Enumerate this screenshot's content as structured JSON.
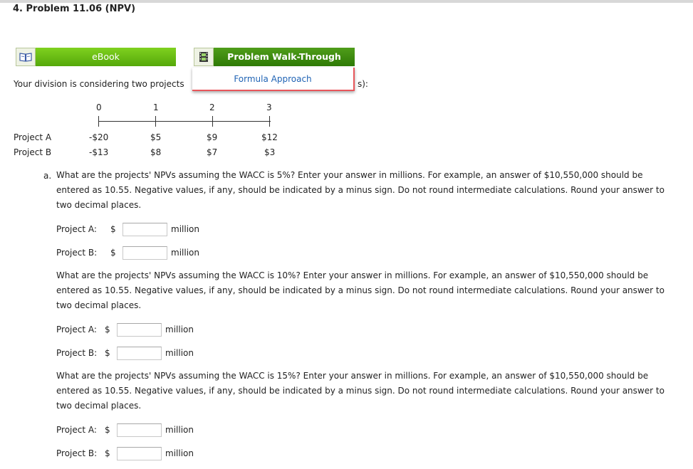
{
  "problem_title": "4. Problem 11.06 (NPV)",
  "buttons": {
    "ebook": "eBook",
    "walkthrough": "Problem Walk-Through"
  },
  "dropdown": {
    "formula_approach": "Formula Approach"
  },
  "intro": {
    "left": "Your division is considering two projects ",
    "right": "s):"
  },
  "timeline": {
    "years": [
      "0",
      "1",
      "2",
      "3"
    ],
    "projects": [
      {
        "label": "Project A",
        "cash_flows": [
          "-$20",
          "$5",
          "$9",
          "$12"
        ]
      },
      {
        "label": "Project B",
        "cash_flows": [
          "-$13",
          "$8",
          "$7",
          "$3"
        ]
      }
    ]
  },
  "questions": [
    {
      "text": "What are the projects' NPVs assuming the WACC is 5%? Enter your answer in millions. For example, an answer of $10,550,000 should be entered as 10.55. Negative values, if any, should be indicated by a minus sign. Do not round intermediate calculations. Round your answer to two decimal places.",
      "letter": "a.",
      "fields": [
        {
          "label": "Project A:",
          "currency": "$",
          "value": "",
          "unit": "million"
        },
        {
          "label": "Project B:",
          "currency": "$",
          "value": "",
          "unit": "million"
        }
      ]
    },
    {
      "text": "What are the projects' NPVs assuming the WACC is 10%? Enter your answer in millions. For example, an answer of $10,550,000 should be entered as 10.55. Negative values, if any, should be indicated by a minus sign. Do not round intermediate calculations. Round your answer to two decimal places.",
      "fields": [
        {
          "label": "Project A:",
          "currency": "$",
          "value": "",
          "unit": "million"
        },
        {
          "label": "Project B:",
          "currency": "$",
          "value": "",
          "unit": "million"
        }
      ]
    },
    {
      "text": "What are the projects' NPVs assuming the WACC is 15%? Enter your answer in millions. For example, an answer of $10,550,000 should be entered as 10.55. Negative values, if any, should be indicated by a minus sign. Do not round intermediate calculations. Round your answer to two decimal places.",
      "fields": [
        {
          "label": "Project A:",
          "currency": "$",
          "value": "",
          "unit": "million"
        },
        {
          "label": "Project B:",
          "currency": "$",
          "value": "",
          "unit": "million"
        }
      ]
    }
  ],
  "icons": {
    "ebook": "book-icon",
    "walkthrough": "film-icon"
  },
  "colors": {
    "ebook_green": "#6cc117",
    "walkthrough_green": "#3f8c10",
    "link_blue": "#1f63b4",
    "highlight_red": "#e8565b"
  }
}
